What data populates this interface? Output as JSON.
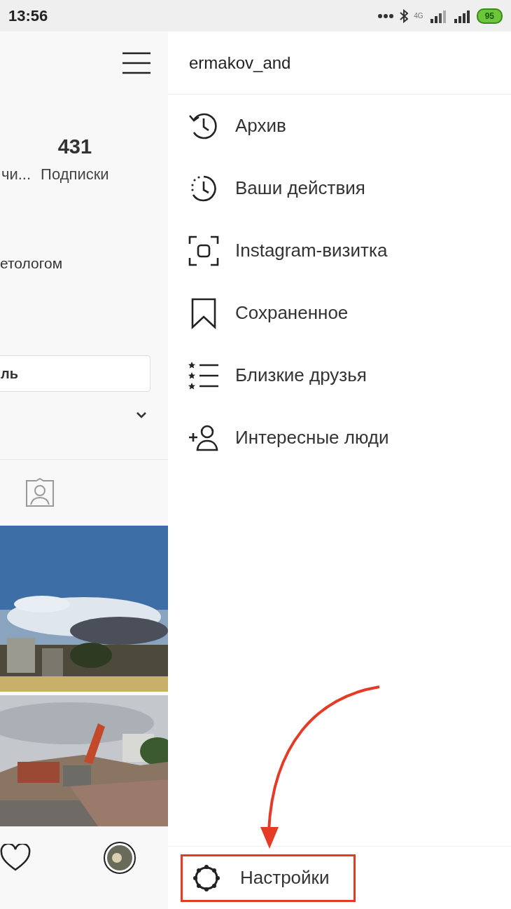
{
  "status_bar": {
    "time": "13:56",
    "network": "4G",
    "battery": "95"
  },
  "profile": {
    "stats": [
      {
        "label": "чи..."
      },
      {
        "value": "431",
        "label": "Подписки"
      }
    ],
    "bio": "етологом",
    "edit_button": "ль"
  },
  "drawer": {
    "username": "ermakov_and",
    "items": [
      {
        "kind": "archive",
        "label": "Архив"
      },
      {
        "kind": "activity",
        "label": "Ваши действия"
      },
      {
        "kind": "nametag",
        "label": "Instagram-визитка"
      },
      {
        "kind": "saved",
        "label": "Сохраненное"
      },
      {
        "kind": "close_friends",
        "label": "Близкие друзья"
      },
      {
        "kind": "discover",
        "label": "Интересные люди"
      }
    ],
    "footer": {
      "label": "Настройки",
      "highlighted": true
    }
  }
}
